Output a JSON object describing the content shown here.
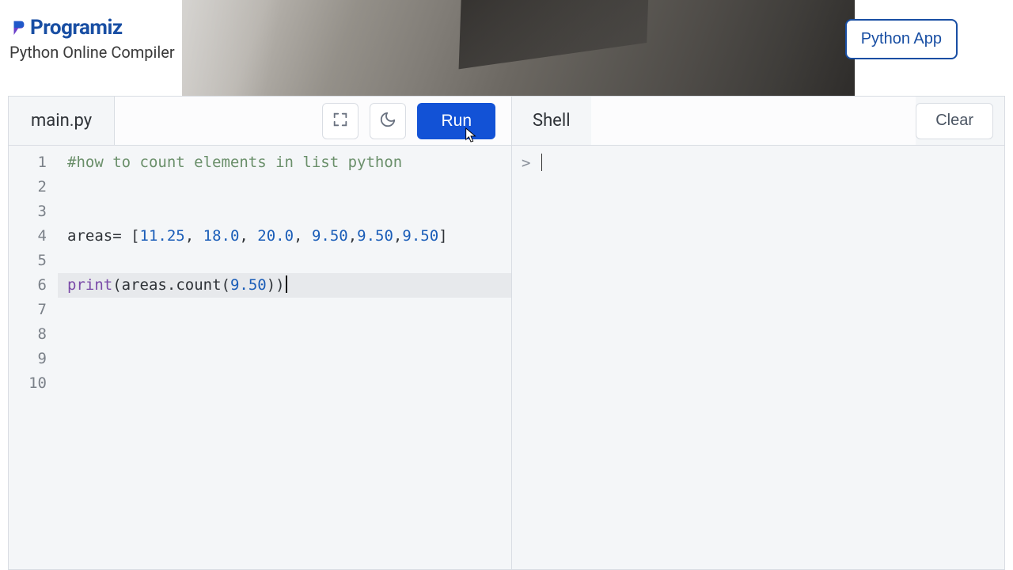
{
  "brand": {
    "name": "Programiz",
    "subtitle": "Python Online Compiler"
  },
  "header": {
    "python_app_btn": "Python App"
  },
  "editor": {
    "filename": "main.py",
    "run_label": "Run",
    "line_count": 10,
    "active_line": 6,
    "code": {
      "l1_comment": "#how to count elements in list python",
      "l4_ident": "areas",
      "l4_assign": "= [",
      "l4_nums": [
        "11.25",
        "18.0",
        "20.0",
        "9.50",
        "9.50",
        "9.50"
      ],
      "l4_close": "]",
      "l6_func": "print",
      "l6_open": "(",
      "l6_obj": "areas",
      "l6_dot": ".",
      "l6_method": "count",
      "l6_open2": "(",
      "l6_arg": "9.50",
      "l6_close": "))"
    }
  },
  "shell": {
    "title": "Shell",
    "clear_label": "Clear",
    "prompt": ">"
  }
}
